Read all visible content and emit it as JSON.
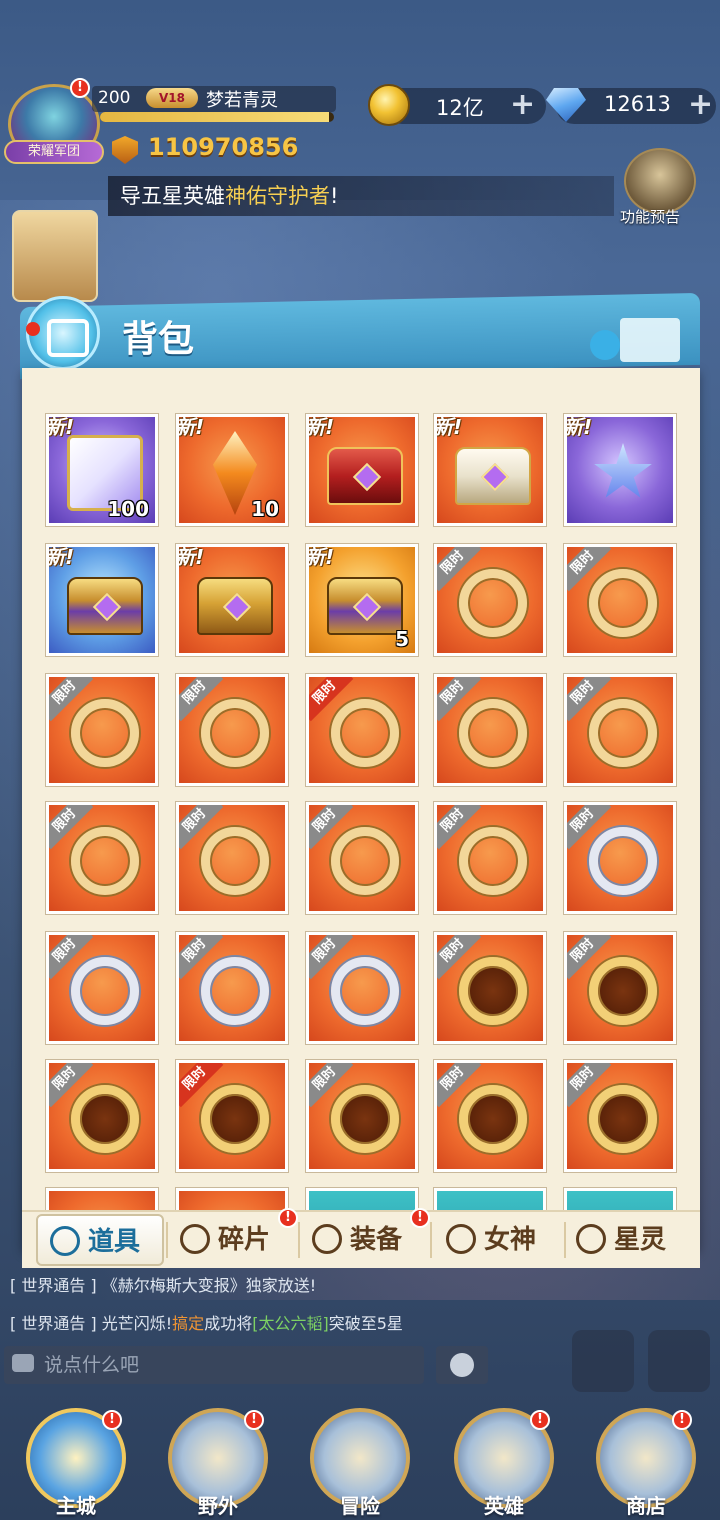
{
  "hud": {
    "guild_tag": "荣耀军团",
    "level": "200",
    "vip": "V18",
    "player_name": "梦若青灵",
    "exp_progress": 0.98,
    "power": "110970856",
    "gold": "12亿",
    "diamonds": "12613",
    "plus": "+",
    "alert": "!"
  },
  "notice": {
    "prefix": "导五星英雄",
    "highlight": "神佑守护者",
    "suffix": "!"
  },
  "feature_preview": {
    "label": "功能预告"
  },
  "panel": {
    "title": "背包",
    "badge_new": "新!",
    "badge_limit": "限时",
    "slots": [
      {
        "kind": "cube",
        "bg": "purple",
        "new": true,
        "count": "100"
      },
      {
        "kind": "crystal",
        "bg": "orange",
        "new": true,
        "count": "10"
      },
      {
        "kind": "chest-red",
        "bg": "orange",
        "new": true
      },
      {
        "kind": "chest-white",
        "bg": "orange",
        "new": true
      },
      {
        "kind": "star",
        "bg": "purple",
        "new": true
      },
      {
        "kind": "chest-purple",
        "bg": "blue",
        "new": true
      },
      {
        "kind": "chest-gold",
        "bg": "orange",
        "new": true
      },
      {
        "kind": "chest-purple",
        "bg": "gold",
        "new": true,
        "count": "5"
      },
      {
        "kind": "ring-gold",
        "bg": "orange",
        "limit": "gray"
      },
      {
        "kind": "ring-gold",
        "bg": "orange",
        "limit": "gray"
      },
      {
        "kind": "ring-gold",
        "bg": "orange",
        "limit": "gray"
      },
      {
        "kind": "ring-gold",
        "bg": "orange",
        "limit": "gray"
      },
      {
        "kind": "ring-gold",
        "bg": "orange",
        "limit": "red"
      },
      {
        "kind": "ring-gold",
        "bg": "orange",
        "limit": "gray"
      },
      {
        "kind": "ring-gold",
        "bg": "orange",
        "limit": "gray"
      },
      {
        "kind": "ring-gold",
        "bg": "orange",
        "limit": "gray"
      },
      {
        "kind": "ring-gold",
        "bg": "orange",
        "limit": "gray"
      },
      {
        "kind": "ring-gold",
        "bg": "orange",
        "limit": "gray"
      },
      {
        "kind": "ring-gold",
        "bg": "orange",
        "limit": "gray"
      },
      {
        "kind": "ring-silver",
        "bg": "orange",
        "limit": "gray"
      },
      {
        "kind": "ring-silver",
        "bg": "orange",
        "limit": "gray"
      },
      {
        "kind": "ring-silver",
        "bg": "orange",
        "limit": "gray"
      },
      {
        "kind": "ring-silver",
        "bg": "orange",
        "limit": "gray"
      },
      {
        "kind": "ring-dark",
        "bg": "orange",
        "limit": "gray"
      },
      {
        "kind": "ring-dark",
        "bg": "orange",
        "limit": "gray"
      },
      {
        "kind": "ring-dark",
        "bg": "orange",
        "limit": "gray"
      },
      {
        "kind": "ring-dark",
        "bg": "orange",
        "limit": "red"
      },
      {
        "kind": "ring-dark",
        "bg": "orange",
        "limit": "gray"
      },
      {
        "kind": "ring-dark",
        "bg": "orange",
        "limit": "gray"
      },
      {
        "kind": "ring-dark",
        "bg": "orange",
        "limit": "gray"
      },
      {
        "kind": "none",
        "bg": "orange"
      },
      {
        "kind": "none",
        "bg": "orange"
      },
      {
        "kind": "none",
        "bg": "teal"
      },
      {
        "kind": "none",
        "bg": "teal"
      },
      {
        "kind": "none",
        "bg": "teal"
      }
    ]
  },
  "tabs": [
    {
      "label": "道具",
      "active": true,
      "alert": false
    },
    {
      "label": "碎片",
      "active": false,
      "alert": true
    },
    {
      "label": "装备",
      "active": false,
      "alert": true
    },
    {
      "label": "女神",
      "active": false,
      "alert": false
    },
    {
      "label": "星灵",
      "active": false,
      "alert": false
    }
  ],
  "chat": {
    "line1_prefix": "[ 世界通告 ] 《赫尔梅斯大变报》独家放送!",
    "line2_prefix": "[ 世界通告 ] 光芒闪烁!",
    "line2_name": "搞定",
    "line2_mid": "成功将",
    "line2_item": "[太公六韬]",
    "line2_suffix": "突破至5星",
    "input_placeholder": "说点什么吧"
  },
  "nav": [
    {
      "label": "主城",
      "active": true,
      "alert": true
    },
    {
      "label": "野外",
      "active": false,
      "alert": true
    },
    {
      "label": "冒险",
      "active": false,
      "alert": false
    },
    {
      "label": "英雄",
      "active": false,
      "alert": true
    },
    {
      "label": "商店",
      "active": false,
      "alert": true
    }
  ],
  "colors": {
    "accent_gold": "#f7c545",
    "panel_blue": "#3b91c0",
    "alert_red": "#e8301f"
  }
}
